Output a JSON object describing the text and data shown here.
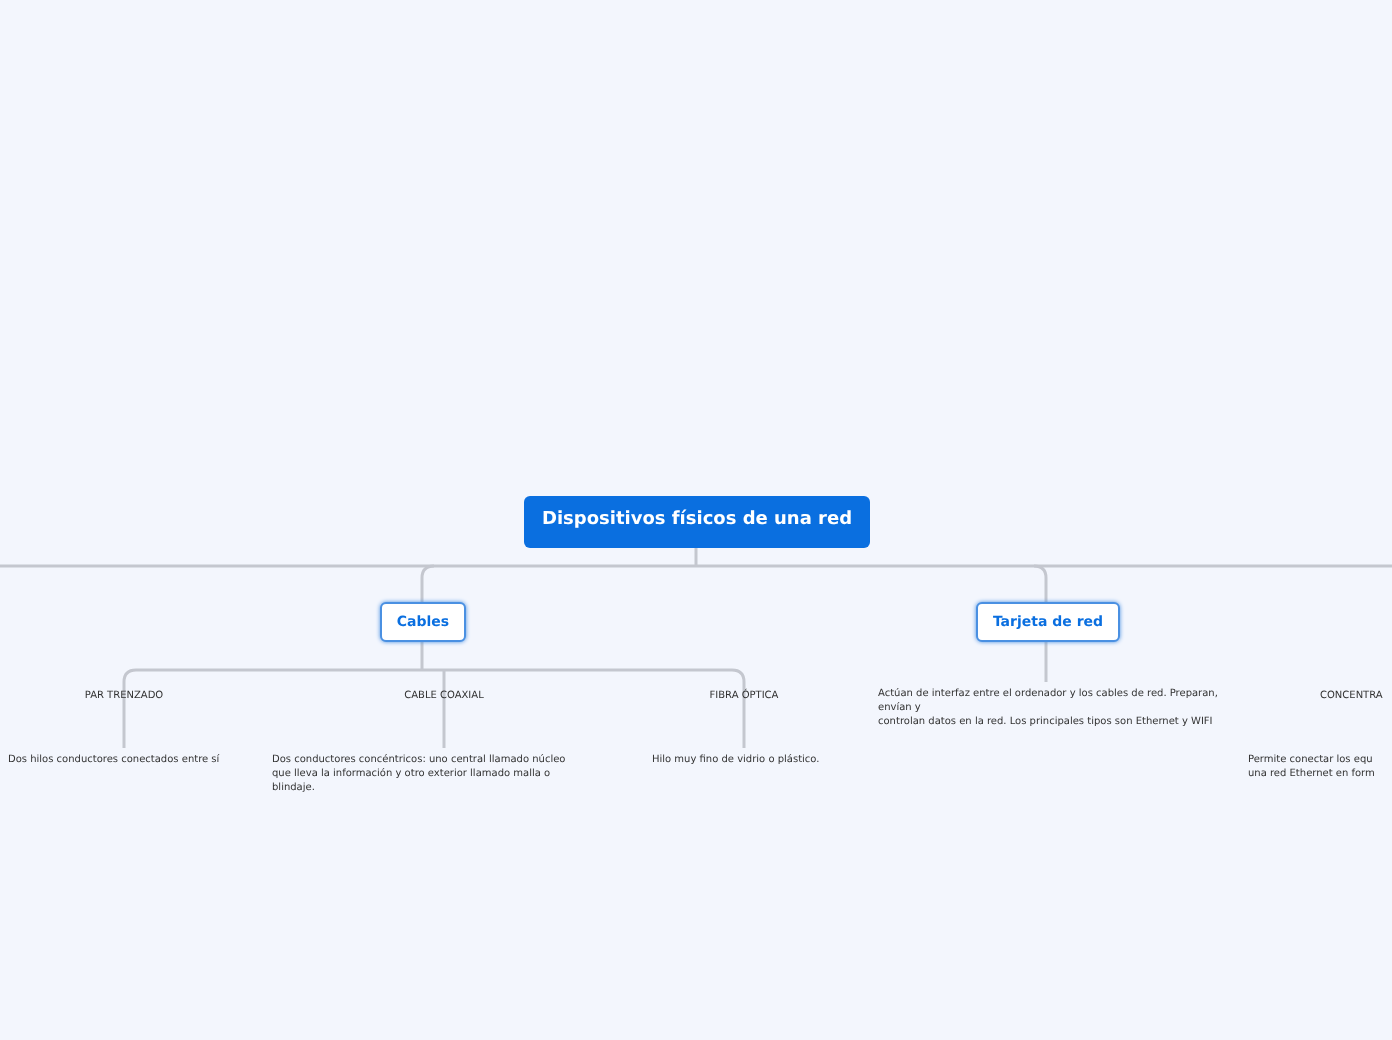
{
  "root": {
    "label": "Dispositivos físicos de una red"
  },
  "branches": [
    {
      "label": "Cables",
      "children": [
        {
          "label": "PAR TRENZADO",
          "description": "Dos hilos conductores conectados entre sí"
        },
        {
          "label": "CABLE COAXIAL",
          "description": "Dos conductores concéntricos: uno central llamado núcleo que lleva la información y otro exterior llamado malla o blindaje."
        },
        {
          "label": "FIBRA ÓPTICA",
          "description": "Hilo muy fino de vidrio o plástico."
        }
      ]
    },
    {
      "label": "Tarjeta de red",
      "description": "Actúan de interfaz entre el ordenador y los cables de red. Preparan, envían y\ncontrolan datos en la red. Los principales tipos son Ethernet y WIFI"
    },
    {
      "label": "CONCENTRA",
      "description": "Permite conectar los equ\nuna red Ethernet en form"
    }
  ]
}
